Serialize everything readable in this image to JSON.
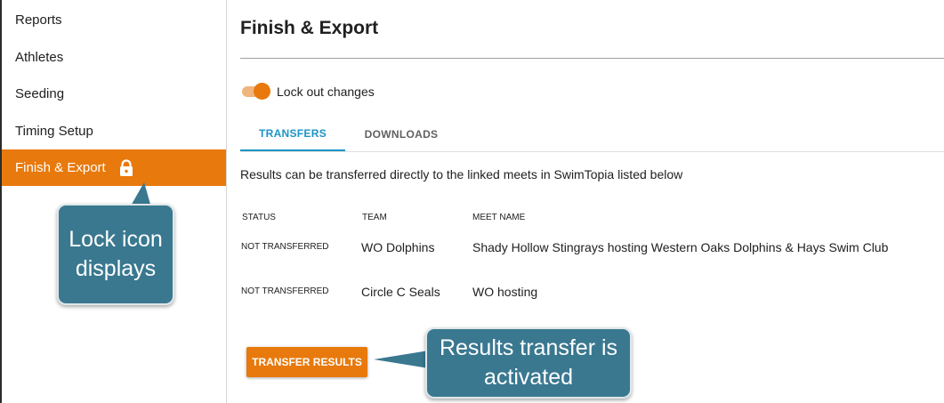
{
  "sidebar": {
    "items": [
      {
        "label": "Reports"
      },
      {
        "label": "Athletes"
      },
      {
        "label": "Seeding"
      },
      {
        "label": "Timing Setup"
      },
      {
        "label": "Finish & Export",
        "active": true,
        "icon": "lock-icon"
      }
    ]
  },
  "annotations": {
    "lock_callout": "Lock icon displays",
    "transfer_callout": "Results transfer is activated"
  },
  "page": {
    "title": "Finish & Export",
    "lock_toggle": {
      "label": "Lock out changes",
      "on": true
    },
    "tabs": [
      {
        "label": "TRANSFERS",
        "active": true
      },
      {
        "label": "DOWNLOADS",
        "active": false
      }
    ],
    "description": "Results can be transferred directly to the linked meets in SwimTopia listed below",
    "table": {
      "headers": [
        "STATUS",
        "TEAM",
        "MEET NAME"
      ],
      "rows": [
        {
          "status": "NOT TRANSFERRED",
          "team": "WO Dolphins",
          "meet": "Shady Hollow Stingrays hosting Western Oaks Dolphins & Hays Swim Club"
        },
        {
          "status": "NOT TRANSFERRED",
          "team": "Circle C Seals",
          "meet": "WO hosting"
        }
      ]
    },
    "transfer_button": "TRANSFER RESULTS"
  },
  "colors": {
    "accent_orange": "#e8790c",
    "tab_blue": "#1b94c6",
    "callout_teal": "#3a7890"
  }
}
